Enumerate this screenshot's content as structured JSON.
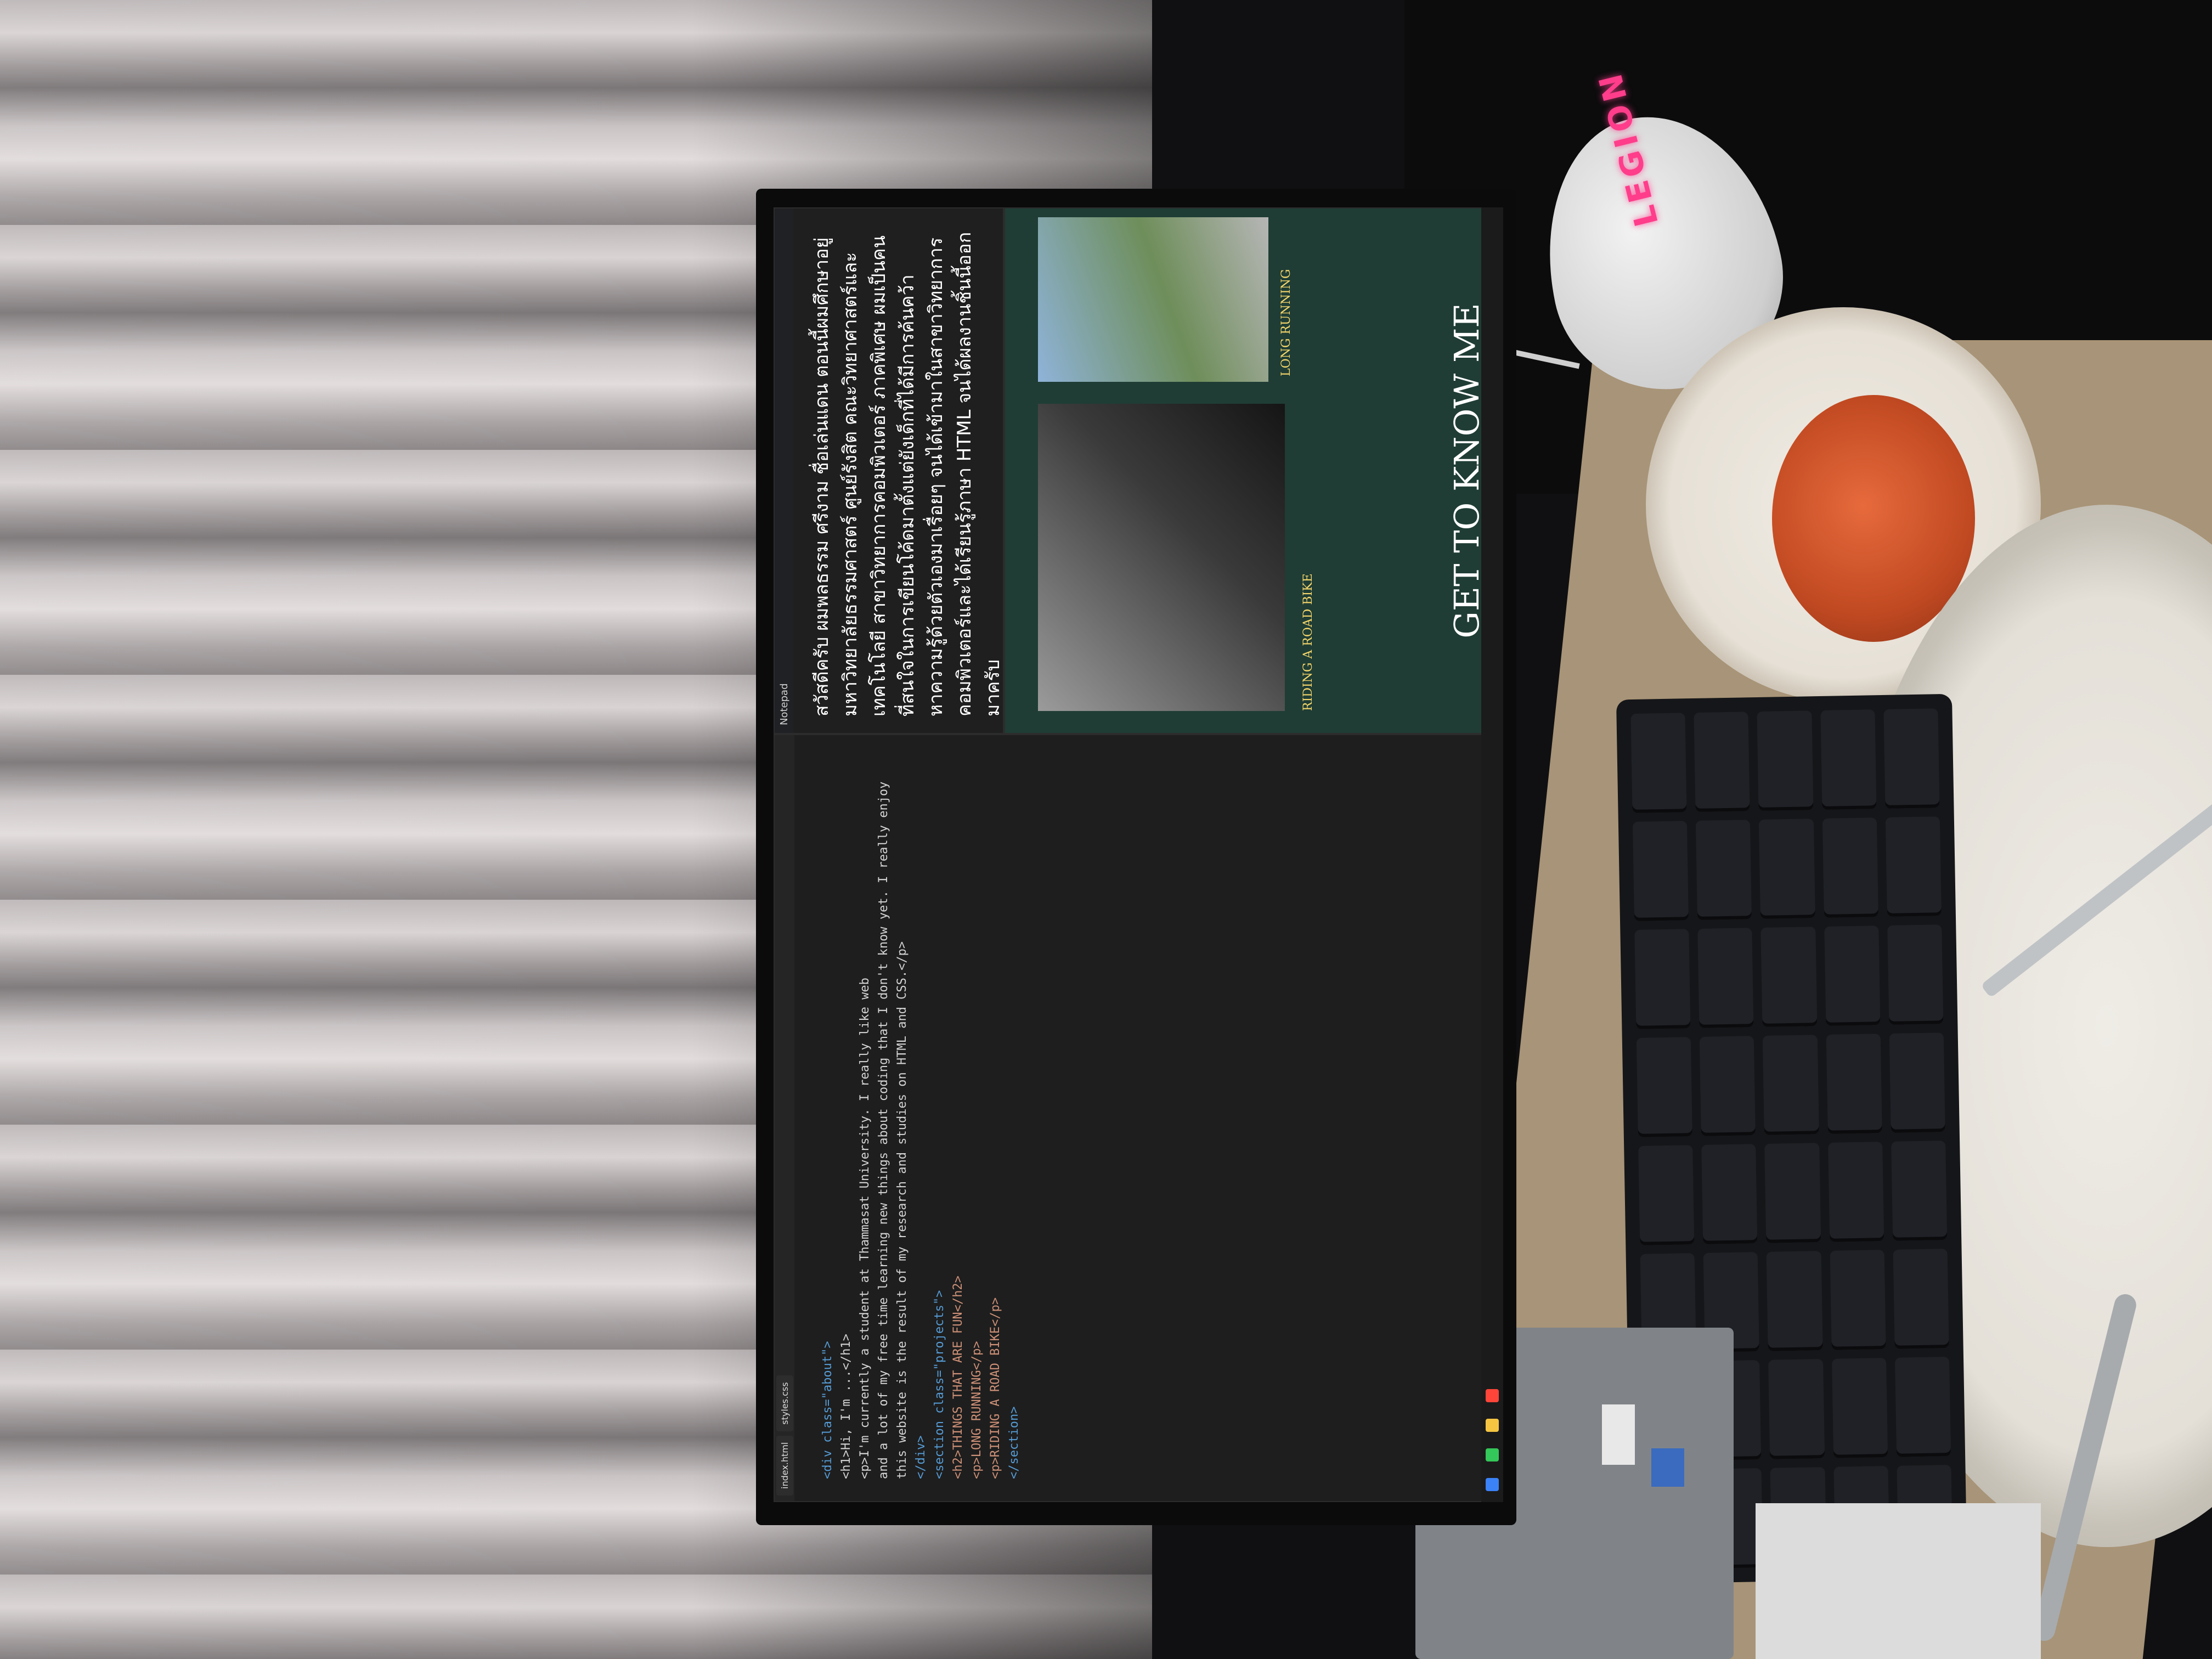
{
  "scene": {
    "mouse_brand": "LEGION"
  },
  "editor": {
    "tabs": [
      "index.html",
      "styles.css"
    ],
    "code_lines": [
      "<div class=\"about\">",
      "  <h1>Hi, I'm ...</h1>",
      "  <p>I'm currently a student at Thammasat University. I really like web",
      "  and a lot of my free time learning new things about coding that I don't know yet. I really enjoy",
      "  this website is the result of my research and studies on HTML and CSS.</p>",
      "</div>",
      "<section class=\"projects\">",
      "  <h2>THINGS THAT ARE FUN</h2>",
      "  <p>LONG RUNNING</p>",
      "  <p>RIDING A ROAD BIKE</p>",
      "</section>"
    ]
  },
  "webpage": {
    "hero_title": "GET TO KNOW ME",
    "label_long": "LONG RUNNING",
    "label_riding": "RIDING A ROAD BIKE"
  },
  "textdoc": {
    "title": "Notepad",
    "body": "สวัสดีครับ ผมพลธรรม ศรีงาม ชื่อเล่นแดน ตอนนี้ผมศึกษาอยู่มหาวิทยาลัยธรรมศาสตร์ ศูนย์รังสิต คณะวิทยาศาสตร์และเทคโนโลยี สาขาวิทยาการคอมพิวเตอร์ ภาคพิเศษ ผมเป็นคนที่สนใจในการเขียนโค้ดมาตั้งแต่ยังเด็กที่ได้มีการค้นคว้าหาความรู้ด้วยตัวเองมาเรื่อยๆ จนได้เข้ามาในสาขาวิทยาการคอมพิวเตอร์และได้เรียนรู้ภาษา HTML จนได้ผลงานชิ้นนี้ออกมาครับ"
  }
}
